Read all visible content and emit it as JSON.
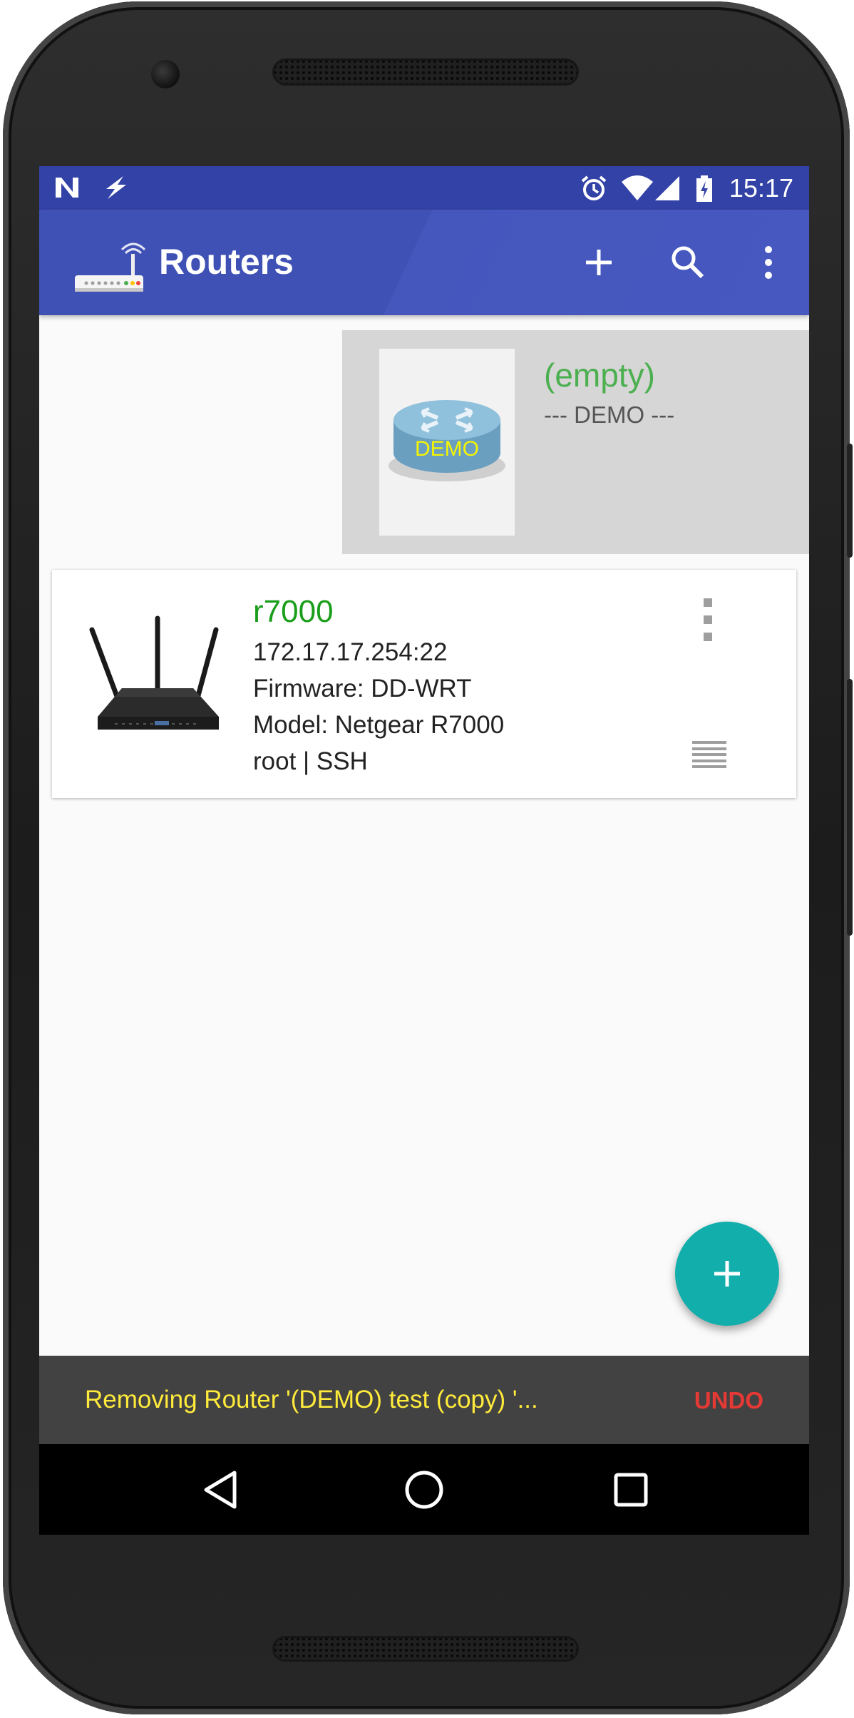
{
  "status_bar": {
    "time": "15:17",
    "left_icons": [
      "n-notification-icon",
      "flash-icon"
    ],
    "right_icons": [
      "alarm-icon",
      "wifi-icon",
      "signal-icon",
      "battery-icon"
    ]
  },
  "app_bar": {
    "title": "Routers",
    "actions": [
      "add-icon",
      "search-icon",
      "overflow-menu-icon"
    ]
  },
  "routers": [
    {
      "name": "(empty)",
      "subtitle": "--- DEMO ---",
      "image_label": "DEMO"
    },
    {
      "name": "r7000",
      "address": "172.17.17.254:22",
      "firmware": "Firmware: DD-WRT",
      "model": "Model: Netgear R7000",
      "auth": "root | SSH"
    }
  ],
  "snackbar": {
    "message": "Removing Router '(DEMO) test (copy) '...",
    "action": "UNDO"
  },
  "colors": {
    "status_bar": "#3342a6",
    "app_bar": "#3f51b5",
    "fab": "#12aeab",
    "router_name_green": "#1a9e1a",
    "snack_text": "#ffeb3b",
    "snack_action": "#e53935"
  }
}
